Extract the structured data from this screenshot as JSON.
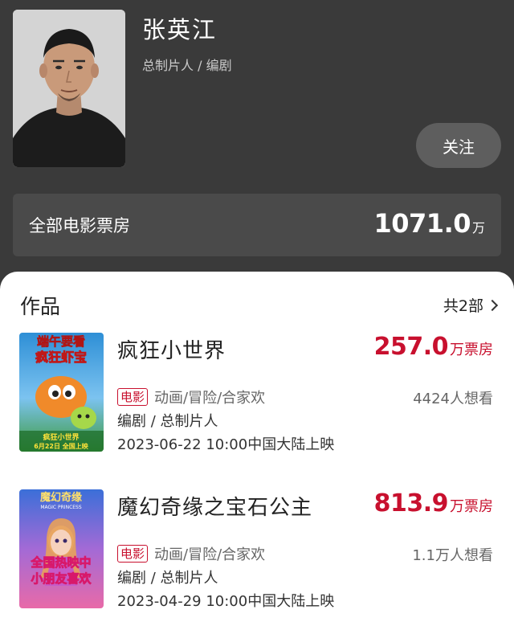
{
  "person": {
    "name": "张英江",
    "roles": "总制片人 / 编剧",
    "follow_label": "关注"
  },
  "boxoffice": {
    "label": "全部电影票房",
    "value": "1071.0",
    "unit": "万"
  },
  "works": {
    "title": "作品",
    "total": "共2部",
    "items": [
      {
        "title": "疯狂小世界",
        "boxoffice_value": "257.0",
        "boxoffice_unit": "万票房",
        "badge": "电影",
        "genres": "动画/冒险/合家欢",
        "want": "4424人想看",
        "role": "编剧 / 总制片人",
        "release": "2023-06-22 10:00中国大陆上映",
        "poster": {
          "line1": "端午要看",
          "line2": "疯狂虾宝",
          "line3": "疯狂小世界",
          "line4": "6月22日 全国上映"
        }
      },
      {
        "title": "魔幻奇缘之宝石公主",
        "boxoffice_value": "813.9",
        "boxoffice_unit": "万票房",
        "badge": "电影",
        "genres": "动画/冒险/合家欢",
        "want": "1.1万人想看",
        "role": "编剧 / 总制片人",
        "release": "2023-04-29 10:00中国大陆上映",
        "poster": {
          "line1": "魔幻奇缘",
          "line2": "MAGIC PRINCESS",
          "line3": "全国热映中",
          "line4": "小朋友喜欢"
        }
      }
    ]
  },
  "colors": {
    "accent_red": "#c8102e",
    "header_bg": "#3a3a3a"
  }
}
